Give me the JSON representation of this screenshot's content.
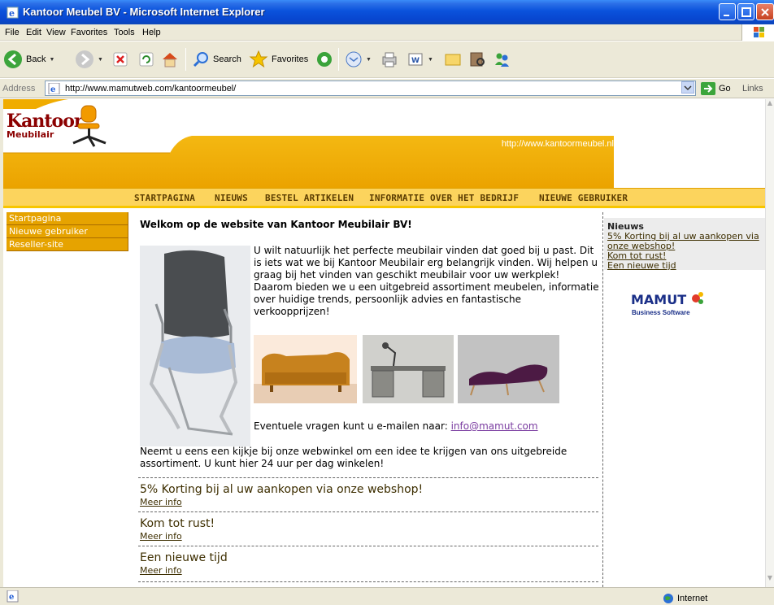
{
  "window": {
    "title": "Kantoor Meubel BV - Microsoft Internet Explorer"
  },
  "menubar": [
    "File",
    "Edit",
    "View",
    "Favorites",
    "Tools",
    "Help"
  ],
  "toolbar": {
    "back_label": "Back",
    "search_label": "Search",
    "favorites_label": "Favorites"
  },
  "addressbar": {
    "label": "Address",
    "url": "http://www.mamutweb.com/kantoormeubel/",
    "go_label": "Go",
    "links_label": "Links"
  },
  "status": {
    "zone": "Internet"
  },
  "page": {
    "logo_word1": "Kantoor",
    "logo_word2": "Meubilair",
    "banner_url": "http://www.kantoormeubel.nl",
    "topnav": [
      "STARTPAGINA",
      "NIEUWS",
      "BESTEL ARTIKELEN",
      "INFORMATIE OVER HET BEDRIJF",
      "NIEUWE GEBRUIKER"
    ],
    "sidebar": [
      "Startpagina",
      "Nieuwe gebruiker",
      "Reseller-site"
    ],
    "main_title": "Welkom op de website van Kantoor Meubilair BV!",
    "intro": "U wilt natuurlijk het perfecte meubilair vinden dat goed bij u past. Dit is iets wat we bij Kantoor Meubilair erg belangrijk vinden. Wij helpen u graag bij het vinden van geschikt meubilair voor uw werkplek! Daarom bieden we u een uitgebreid assortiment meubelen, informatie over huidige trends, persoonlijk advies en fantastische verkoopprijzen!",
    "email_prefix": "Eventuele vragen kunt u e-mailen naar:",
    "email": "info@mamut.com",
    "webshop_text": "Neemt u eens een kijkje bij onze webwinkel om een idee te krijgen van ons uitgebreide assortiment. U kunt hier 24 uur per dag winkelen!",
    "news": [
      {
        "title": "5% Korting bij al uw aankopen via onze webshop!",
        "more": "Meer info"
      },
      {
        "title": "Kom tot rust!",
        "more": "Meer info"
      },
      {
        "title": "Een nieuwe tijd",
        "more": "Meer info"
      }
    ],
    "right_box": {
      "heading": "Nieuws",
      "links": [
        "5% Korting bij al uw aankopen via onze webshop!",
        "Kom tot rust!",
        "Een nieuwe tijd"
      ]
    },
    "mamut": {
      "logo_text": "MAMUT",
      "sub_text": "Business Software"
    }
  },
  "colors": {
    "banner_orange": "#f0ac00",
    "nav_yellow": "#fcd45d",
    "sidebar_orange": "#e6a300",
    "logo_red": "#8b0000"
  }
}
